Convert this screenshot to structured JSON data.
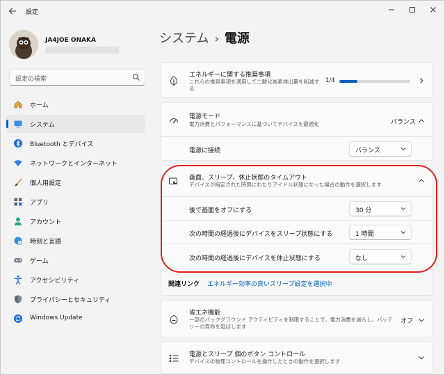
{
  "window": {
    "title": "設定"
  },
  "user": {
    "name": "JA4JOE ONAKA"
  },
  "search": {
    "placeholder": "設定の検索"
  },
  "nav": {
    "items": [
      {
        "label": "ホーム",
        "icon": "home-icon"
      },
      {
        "label": "システム",
        "icon": "system-icon",
        "active": true
      },
      {
        "label": "Bluetooth とデバイス",
        "icon": "bluetooth-icon"
      },
      {
        "label": "ネットワークとインターネット",
        "icon": "wifi-icon"
      },
      {
        "label": "個人用設定",
        "icon": "brush-icon"
      },
      {
        "label": "アプリ",
        "icon": "apps-icon"
      },
      {
        "label": "アカウント",
        "icon": "account-icon"
      },
      {
        "label": "時刻と言語",
        "icon": "globe-clock-icon"
      },
      {
        "label": "ゲーム",
        "icon": "gamepad-icon"
      },
      {
        "label": "アクセシビリティ",
        "icon": "accessibility-icon"
      },
      {
        "label": "プライバシーとセキュリティ",
        "icon": "shield-icon"
      },
      {
        "label": "Windows Update",
        "icon": "update-icon"
      }
    ]
  },
  "breadcrumb": {
    "parent": "システム",
    "separator": "›",
    "current": "電源"
  },
  "energy": {
    "title": "エネルギーに関する推奨事項",
    "desc": "これらの推奨事項を適用して二酸化炭素排出量を削減する",
    "progress_text": "1/4",
    "progress_value": 0.25
  },
  "power_mode": {
    "title": "電源モード",
    "desc": "電力消費とパフォーマンスに基づいてデバイスを最適化",
    "value": "バランス",
    "plugged_label": "電源に接続",
    "plugged_value": "バランス"
  },
  "screen_sleep": {
    "title": "画面、スリープ、休止状態のタイムアウト",
    "desc": "デバイスが指定された時間にわたりアイドル状態になった場合の動作を選択します",
    "rows": [
      {
        "label": "後で画面をオフにする",
        "value": "30 分"
      },
      {
        "label": "次の時間の経過後にデバイスをスリープ状態にする",
        "value": "1 時間"
      },
      {
        "label": "次の時間の経過後にデバイスを休止状態にする",
        "value": "なし"
      }
    ],
    "related_label": "関連リンク",
    "related_link": "エネルギー効率の良いスリープ設定を選択中"
  },
  "energy_saver": {
    "title": "省エネ機能",
    "desc": "一部のバックグラウンド アクティビティを制限することで、電力消費を減らし、バッテリーの寿命を延ばします",
    "value": "オフ"
  },
  "buttons": {
    "title": "電源とスリープ 個のボタン コントロール",
    "desc": "デバイスの物理コントロールを操作したときの動作を選択します"
  },
  "colors": {
    "accent": "#005fb8",
    "highlight": "#e02020"
  }
}
